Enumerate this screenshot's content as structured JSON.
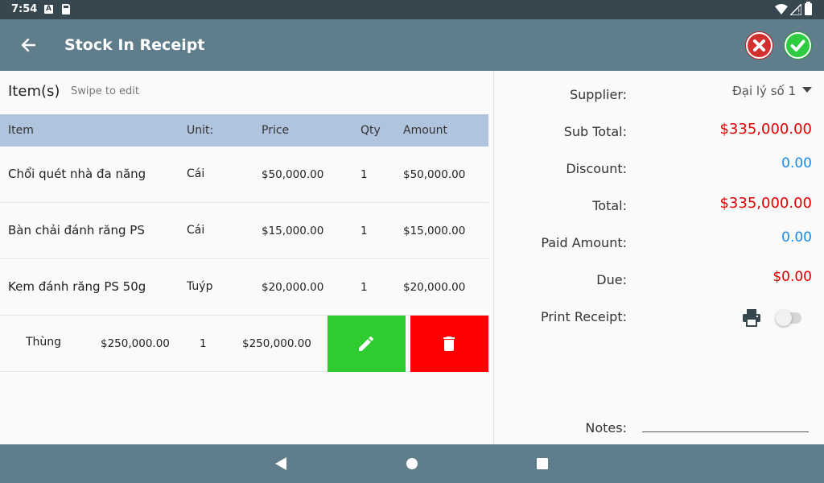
{
  "status_bar": {
    "time": "7:54",
    "icons": [
      "notification-a-icon",
      "sd-card-icon",
      "wifi-icon",
      "signal-icon",
      "battery-icon"
    ]
  },
  "app_bar": {
    "title": "Stock In Receipt",
    "back_icon": "arrow-left-icon",
    "cancel_icon": "close-circle-icon",
    "confirm_icon": "check-circle-icon",
    "colors": {
      "bar": "#607d8b",
      "cancel": "#d32f2f",
      "confirm": "#2ecc40"
    }
  },
  "items": {
    "label": "Item(s)",
    "hint": "Swipe to edit",
    "columns": {
      "item": "Item",
      "unit": "Unit:",
      "price": "Price",
      "qty": "Qty",
      "amount": "Amount"
    },
    "rows": [
      {
        "name": "Chổi quét nhà đa năng",
        "unit": "Cái",
        "price": "$50,000.00",
        "qty": "1",
        "amount": "$50,000.00"
      },
      {
        "name": "Bàn chải đánh răng PS",
        "unit": "Cái",
        "price": "$15,000.00",
        "qty": "1",
        "amount": "$15,000.00"
      },
      {
        "name": "Kem đánh răng PS 50g",
        "unit": "Tuýp",
        "price": "$20,000.00",
        "qty": "1",
        "amount": "$20,000.00"
      }
    ],
    "swiped_row": {
      "unit": "Thùng",
      "price": "$250,000.00",
      "qty": "1",
      "amount": "$250,000.00"
    },
    "swipe_actions": {
      "edit_icon": "pencil-icon",
      "delete_icon": "trash-icon",
      "edit_color": "#2ecc2e",
      "delete_color": "#ff0000"
    }
  },
  "summary": {
    "supplier_label": "Supplier:",
    "supplier_value": "Đại lý số 1",
    "subtotal_label": "Sub Total:",
    "subtotal_value": "$335,000.00",
    "discount_label": "Discount:",
    "discount_value": "0.00",
    "total_label": "Total:",
    "total_value": "$335,000.00",
    "paid_label": "Paid Amount:",
    "paid_value": "0.00",
    "due_label": "Due:",
    "due_value": "$0.00",
    "print_label": "Print Receipt:",
    "print_enabled": false,
    "notes_label": "Notes:",
    "notes_value": ""
  },
  "nav_bar": {
    "icons": [
      "nav-back-icon",
      "nav-home-icon",
      "nav-recents-icon"
    ]
  }
}
